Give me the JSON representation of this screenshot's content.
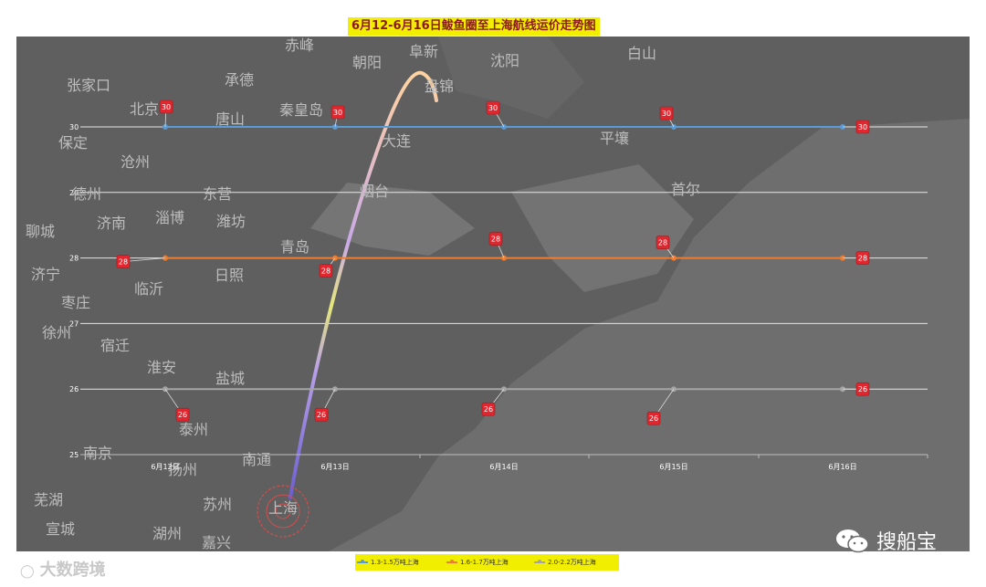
{
  "title": "6月12-6月16日鲅鱼圈至上海航线运价走势图",
  "chart_data": {
    "type": "line",
    "categories": [
      "6月12日",
      "6月13日",
      "6月14日",
      "6月15日",
      "6月16日"
    ],
    "ylim": [
      25,
      30
    ],
    "y_ticks": [
      "30",
      "29",
      "28",
      "27",
      "26",
      "25"
    ],
    "series": [
      {
        "name": "1.3-1.5万吨上海",
        "values": [
          30,
          30,
          30,
          30,
          30
        ],
        "labels": [
          "30",
          "30",
          "30",
          "30",
          "30"
        ],
        "color": "#5b9bd5"
      },
      {
        "name": "1.6-1.7万吨上海",
        "values": [
          28,
          28,
          28,
          28,
          28
        ],
        "labels": [
          "28",
          "28",
          "28",
          "28",
          "28"
        ],
        "color": "#ed7d31"
      },
      {
        "name": "2.0-2.2万吨上海",
        "values": [
          26,
          26,
          26,
          26,
          26
        ],
        "labels": [
          "26",
          "26",
          "26",
          "26",
          "26"
        ],
        "color": "#a5a5a5"
      }
    ],
    "grid": true,
    "legend": "bottom"
  },
  "map_cities": [
    "赤峰",
    "阜新",
    "朝阳",
    "沈阳",
    "白山",
    "张家口",
    "承德",
    "盘锦",
    "北京",
    "唐山",
    "秦皇岛",
    "保定",
    "大连",
    "平壤",
    "沧州",
    "烟台",
    "首尔",
    "德州",
    "东营",
    "济南",
    "淄博",
    "潍坊",
    "聊城",
    "青岛",
    "济宁",
    "日照",
    "临沂",
    "枣庄",
    "徐州",
    "宿迁",
    "淮安",
    "盐城",
    "泰州",
    "南京",
    "南通",
    "扬州",
    "芜湖",
    "苏州",
    "上海",
    "宣城",
    "湖州",
    "嘉兴"
  ],
  "footer": {
    "left_text": "大数跨境",
    "brand": "搜船宝"
  },
  "colors": {
    "series1": "#5b9bd5",
    "series2": "#ed7d31",
    "series3": "#a5a5a5",
    "title_bg": "#f2ee00",
    "tag": "#e0262e"
  }
}
